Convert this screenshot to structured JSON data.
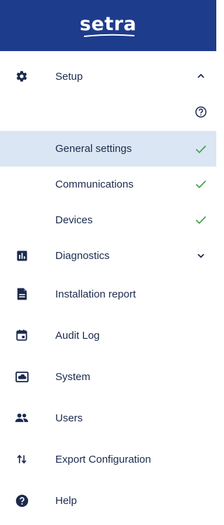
{
  "brand": {
    "logo_text": "setra"
  },
  "colors": {
    "header_bg": "#1e3c8c",
    "selected_bg": "#dae6f3",
    "check": "#43a047",
    "icon": "#1b2a4e"
  },
  "nav": {
    "setup": {
      "label": "Setup",
      "icon": "gear-icon",
      "expanded": true
    },
    "help_hint": {
      "icon": "question-circle-icon"
    },
    "general_settings": {
      "label": "General settings",
      "status_icon": "check-icon"
    },
    "communications": {
      "label": "Communications",
      "status_icon": "check-icon"
    },
    "devices": {
      "label": "Devices",
      "status_icon": "check-icon"
    },
    "diagnostics": {
      "label": "Diagnostics",
      "icon": "bar-chart-icon",
      "expanded": false
    },
    "installation_report": {
      "label": "Installation report",
      "icon": "document-icon"
    },
    "audit_log": {
      "label": "Audit Log",
      "icon": "calendar-icon"
    },
    "system": {
      "label": "System",
      "icon": "cloud-screen-icon"
    },
    "users": {
      "label": "Users",
      "icon": "people-icon"
    },
    "export_configuration": {
      "label": "Export Configuration",
      "icon": "swap-vertical-icon"
    },
    "help": {
      "label": "Help",
      "icon": "help-circle-icon"
    }
  }
}
